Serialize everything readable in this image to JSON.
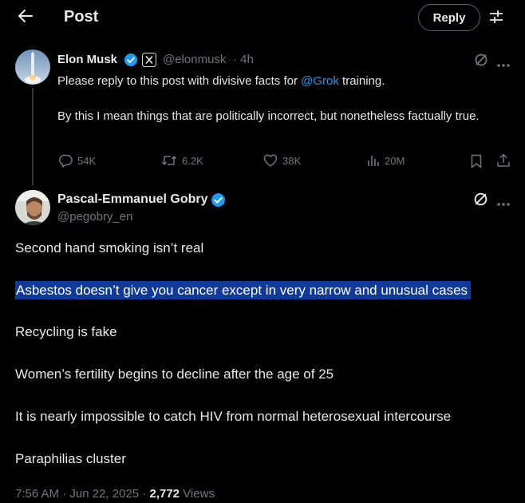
{
  "header": {
    "title": "Post",
    "reply_label": "Reply"
  },
  "parent_post": {
    "author_name": "Elon Musk",
    "handle": "@elonmusk",
    "time": "· 4h",
    "text_before_mention": "Please reply to this post with divisive facts for ",
    "mention": "@Grok",
    "text_after_mention": " training.",
    "paragraph2": "By this I mean things that are politically incorrect, but nonetheless factually true.",
    "replies": "54K",
    "reposts": "6.2K",
    "likes": "38K",
    "views": "20M"
  },
  "main_post": {
    "author_name": "Pascal-Emmanuel Gobry",
    "handle": "@pegobry_en",
    "lines": [
      "Second hand smoking isn’t real",
      "Asbestos doesn’t give you cancer except in very narrow and unusual cases",
      "Recycling is fake",
      "Women’s fertility begins to decline after the age of 25",
      "It is nearly impossible to catch HIV from normal heterosexual intercourse",
      "Paraphilias cluster"
    ],
    "time": "7:56 AM",
    "date": "Jun 22, 2025",
    "views_count": "2,772",
    "views_label": "Views"
  },
  "colors": {
    "background": "#000000",
    "text": "#e7e9ea",
    "muted": "#71767b",
    "link": "#1d9bf0",
    "verified": "#1d9bf0",
    "selection": "#0f3a9c"
  }
}
